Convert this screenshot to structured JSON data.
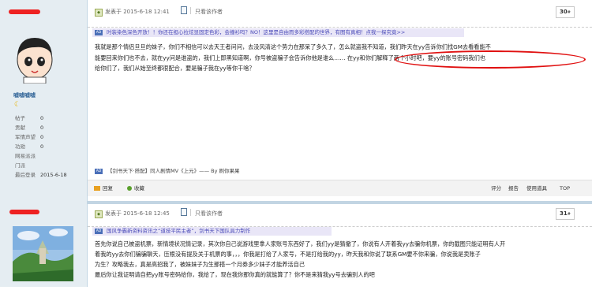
{
  "post1": {
    "time": "发表于 2015-6-18 12:41",
    "only_author": "只看该作者",
    "floor_num": "30",
    "floor_mark": "#",
    "ad_tag": "AD",
    "ad_text": "时装染色深色开放！！你还在担心拉炫显固定色彩，会撞衫吗？NO！这里是自由而多彩搭配的世界，有图有真相！点我一探究竟>>",
    "lines": [
      "我就是那个情侣旦旦的妹子，你们不相信可以去天王者问问，去没风清这个势力在那呆了多久了，怎么就盗我不知道，我们昨天在yy告诉你们找GM去看看能不",
      "能要回来你们也不去，就在yy问是谁盗的，我们上即黑知道啊，你号被盗骗子会告诉你他是谁么…… 在yy和你们解释了两个小时吧，要yy的账号密码我们也",
      "给你们了，我们从始至终都很配合，要是骗子我在yy等你干啥？"
    ],
    "sig_tag": "AD",
    "signature": "【剑书天下·搭配】同人剧情MV《上元》—— By 刷你果果",
    "actions": {
      "reply": "回复",
      "like": "收藏",
      "score": "评分",
      "report": "报告",
      "use_item": "使用道具",
      "top": "TOP"
    }
  },
  "user1": {
    "name": "嘘嘘嘘嘘",
    "stats": [
      {
        "k": "帖子",
        "v": "0"
      },
      {
        "k": "贡献",
        "v": "0"
      },
      {
        "k": "军情声望",
        "v": "0"
      },
      {
        "k": "功勋",
        "v": "0"
      },
      {
        "k": "网易派派",
        "v": ""
      },
      {
        "k": "门派",
        "v": ""
      },
      {
        "k": "最后登录",
        "v": "2015-6-18"
      }
    ]
  },
  "post2": {
    "time": "发表于 2015-6-18 12:45",
    "only_author": "只看该作者",
    "floor_num": "31",
    "floor_mark": "#",
    "ad_tag": "AD",
    "ad_text": "国风争霸新资料资讯之“道技平民主者”，剑书天下国队具力制作",
    "lines": [
      "首先你说自己被盗机票，新情境状况情记录，其次你自己说游戏里拿人家账号东西好了，我们yy是猜撤了，你说有人开着我yy去骗你机票，你的截图只能证明有人开",
      "着我的yy去你们骗骗聊天，压根没有提及关于机票的事，，，你我是打给了人家号，不是打给我的yy，昨天我和你说了联系GM要不你来骗，你说我是卖账子",
      "为生？攻略我去，真是高招我了，被妹妹子为生那搭一个月券多少妹子才能养活自己",
      "最后你让我证明请自把yy账号密码给你，我给了，现在我你那你真的就能算了？你不是来猜我yy号去骗别人的吧"
    ]
  },
  "colors": {
    "accent": "#336699",
    "highlight": "#e01010",
    "ad_bg": "#e9e6f7"
  }
}
